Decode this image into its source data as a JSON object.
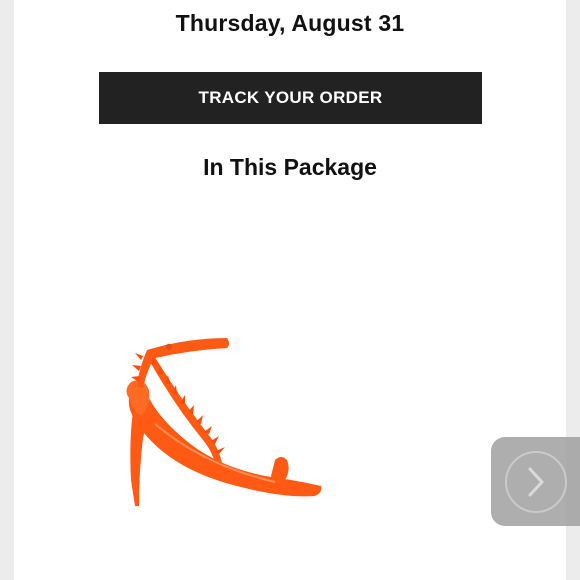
{
  "email": {
    "delivery_date": "Thursday, August 31",
    "track_button_label": "TRACK YOUR ORDER",
    "package_heading": "In This Package"
  },
  "product": {
    "image_subject": "orange spiked strappy high-heel sandal",
    "color": "#ff5a1a"
  },
  "carousel": {
    "next_icon": "chevron-right-icon"
  }
}
